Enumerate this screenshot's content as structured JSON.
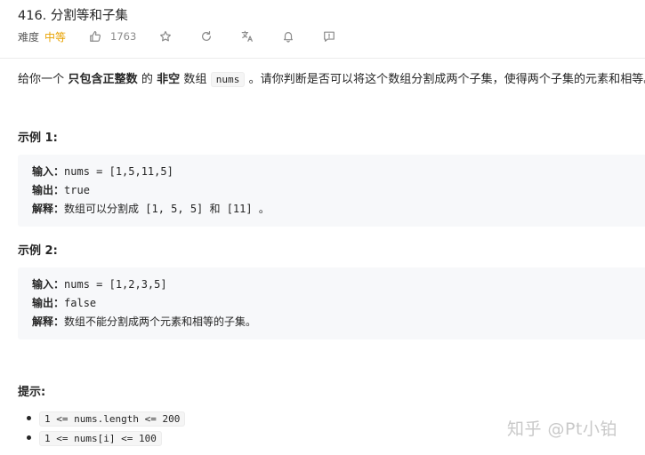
{
  "problem": {
    "title": "416. 分割等和子集",
    "difficulty_label": "难度",
    "difficulty": "中等",
    "likes": "1763"
  },
  "description": {
    "part1": "给你一个 ",
    "bold1": "只包含正整数",
    "part2": " 的 ",
    "bold2": "非空",
    "part3": " 数组 ",
    "code": "nums",
    "part4": " 。请你判断是否可以将这个数组分割成两个子集，使得两个子集的元素和相等。"
  },
  "examples": [
    {
      "heading": "示例 1:",
      "input_label": "输入：",
      "input": "nums = [1,5,11,5]",
      "output_label": "输出：",
      "output": "true",
      "explain_label": "解释：",
      "explain": "数组可以分割成 [1, 5, 5] 和 [11] 。"
    },
    {
      "heading": "示例 2:",
      "input_label": "输入：",
      "input": "nums = [1,2,3,5]",
      "output_label": "输出：",
      "output": "false",
      "explain_label": "解释：",
      "explain": "数组不能分割成两个元素和相等的子集。"
    }
  ],
  "tips": {
    "heading": "提示:",
    "items": [
      "1 <= nums.length <= 200",
      "1 <= nums[i] <= 100"
    ]
  },
  "watermark": "知乎 @Pt小铂",
  "icons": [
    "thumbs-up-icon",
    "star-icon",
    "refresh-icon",
    "translate-icon",
    "bell-icon",
    "feedback-icon"
  ],
  "colors": {
    "difficulty": "#e8a200",
    "code_bg": "#f7f8fa"
  }
}
